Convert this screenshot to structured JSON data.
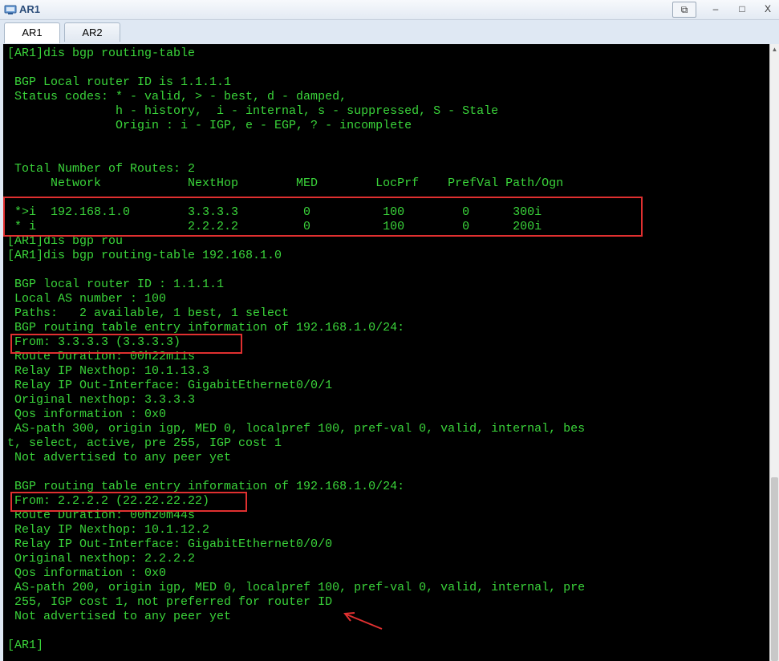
{
  "window": {
    "title": "AR1",
    "controls": [
      "⧉",
      "–",
      "□",
      "X"
    ]
  },
  "tabs": [
    {
      "label": "AR1"
    },
    {
      "label": "AR2"
    }
  ],
  "terminal": {
    "lines": [
      "[AR1]dis bgp routing-table",
      "",
      " BGP Local router ID is 1.1.1.1",
      " Status codes: * - valid, > - best, d - damped,",
      "               h - history,  i - internal, s - suppressed, S - Stale",
      "               Origin : i - IGP, e - EGP, ? - incomplete",
      "",
      "",
      " Total Number of Routes: 2",
      "      Network            NextHop        MED        LocPrf    PrefVal Path/Ogn",
      "",
      " *>i  192.168.1.0        3.3.3.3         0          100        0      300i",
      " * i                     2.2.2.2         0          100        0      200i",
      "[AR1]dis bgp rou",
      "[AR1]dis bgp routing-table 192.168.1.0",
      "",
      " BGP local router ID : 1.1.1.1",
      " Local AS number : 100",
      " Paths:   2 available, 1 best, 1 select",
      " BGP routing table entry information of 192.168.1.0/24:",
      " From: 3.3.3.3 (3.3.3.3)",
      " Route Duration: 00h22m11s",
      " Relay IP Nexthop: 10.1.13.3",
      " Relay IP Out-Interface: GigabitEthernet0/0/1",
      " Original nexthop: 3.3.3.3",
      " Qos information : 0x0",
      " AS-path 300, origin igp, MED 0, localpref 100, pref-val 0, valid, internal, bes",
      "t, select, active, pre 255, IGP cost 1",
      " Not advertised to any peer yet",
      "",
      " BGP routing table entry information of 192.168.1.0/24:",
      " From: 2.2.2.2 (22.22.22.22)",
      " Route Duration: 00h20m44s",
      " Relay IP Nexthop: 10.1.12.2",
      " Relay IP Out-Interface: GigabitEthernet0/0/0",
      " Original nexthop: 2.2.2.2",
      " Qos information : 0x0",
      " AS-path 200, origin igp, MED 0, localpref 100, pref-val 0, valid, internal, pre",
      " 255, IGP cost 1, not preferred for router ID",
      " Not advertised to any peer yet",
      "",
      "[AR1]"
    ]
  },
  "colors": {
    "terminal_text": "#3ad43a",
    "terminal_bg": "#000000",
    "highlight": "#e03030"
  }
}
